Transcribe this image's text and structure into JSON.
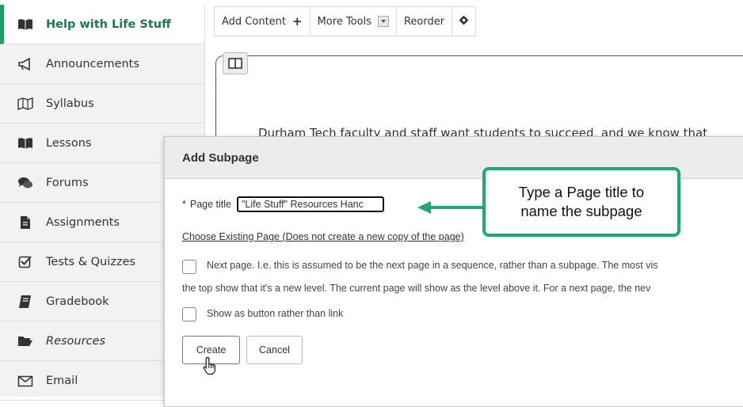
{
  "sidebar": {
    "items": [
      {
        "label": "Help with Life Stuff",
        "icon": "book-open-icon"
      },
      {
        "label": "Announcements",
        "icon": "megaphone-icon"
      },
      {
        "label": "Syllabus",
        "icon": "map-icon"
      },
      {
        "label": "Lessons",
        "icon": "book-open-icon"
      },
      {
        "label": "Forums",
        "icon": "chat-bubbles-icon"
      },
      {
        "label": "Assignments",
        "icon": "file-icon"
      },
      {
        "label": "Tests & Quizzes",
        "icon": "checkbox-icon"
      },
      {
        "label": "Gradebook",
        "icon": "gradebook-icon"
      },
      {
        "label": "Resources",
        "icon": "folder-open-icon"
      },
      {
        "label": "Email",
        "icon": "envelope-icon"
      }
    ]
  },
  "toolbar": {
    "add_content": "Add Content",
    "more_tools": "More Tools",
    "reorder": "Reorder"
  },
  "main": {
    "intro_text": "Durham Tech faculty and staff want students to succeed, and we know that"
  },
  "dialog": {
    "title": "Add Subpage",
    "required_mark": "*",
    "page_title_label": "Page title",
    "page_title_value": "\"Life Stuff\" Resources Hanc",
    "choose_existing": "Choose Existing Page (Does not create a new copy of the page)",
    "next_page_text_1": "Next page. I.e. this is assumed to be the next page in a sequence, rather than a subpage. The most vis",
    "next_page_text_2": "the top show that it's a new level. The current page will show as the level above it. For a next page, the nev",
    "show_button_text": "Show as button rather than link",
    "create_label": "Create",
    "cancel_label": "Cancel"
  },
  "callout": {
    "line1": "Type a Page title to",
    "line2": "name the subpage"
  },
  "colors": {
    "accent": "#1d9c63",
    "callout_border": "#1daa74"
  }
}
